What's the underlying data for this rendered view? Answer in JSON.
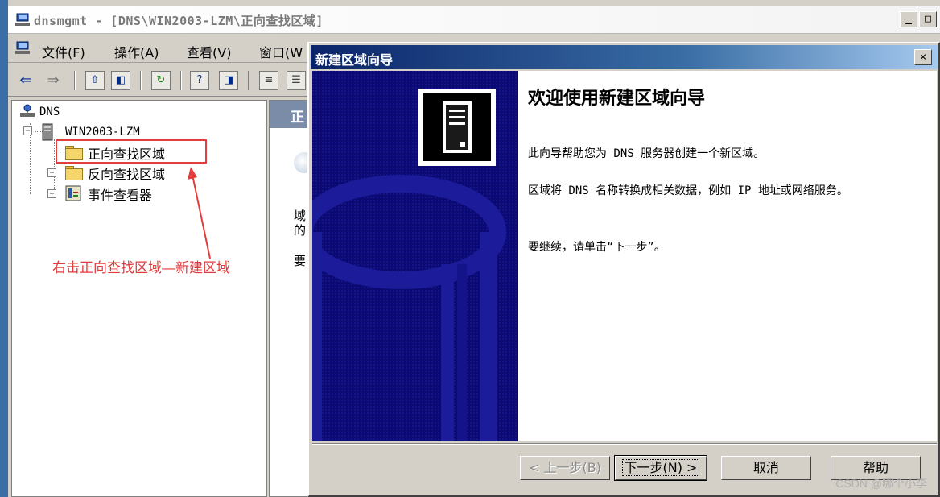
{
  "outer_window": {
    "title": "dnsmgmt - [DNS\\WIN2003-LZM\\正向查找区域]",
    "minimize_label": "_",
    "restore_label": "□"
  },
  "menu": {
    "items": [
      "文件(F)",
      "操作(A)",
      "查看(V)",
      "窗口(W"
    ]
  },
  "tree": {
    "root": "DNS",
    "server": "WIN2003-LZM",
    "items": [
      {
        "label": "正向查找区域",
        "expander": ""
      },
      {
        "label": "反向查找区域",
        "expander": "+"
      },
      {
        "label": "事件查看器",
        "expander": "+"
      }
    ],
    "server_expander": "−"
  },
  "annotation": {
    "text": "右击正向查找区域—新建区域",
    "color": "#e03a3a"
  },
  "result_pane": {
    "header": "正",
    "line1": "域",
    "line2": "的",
    "line3": "要"
  },
  "wizard": {
    "title": "新建区域向导",
    "close_label": "×",
    "heading": "欢迎使用新建区域向导",
    "para1": "此向导帮助您为 DNS 服务器创建一个新区域。",
    "para2": "区域将 DNS 名称转换成相关数据，例如 IP 地址或网络服务。",
    "para3": "要继续，请单击“下一步”。",
    "buttons": {
      "back": "< 上一步(B)",
      "next": "下一步(N) >",
      "cancel": "取消",
      "help": "帮助"
    },
    "banner_color": "#0b0a72",
    "title_color": "#0a246a"
  },
  "watermark": "CSDN @哪个小李"
}
